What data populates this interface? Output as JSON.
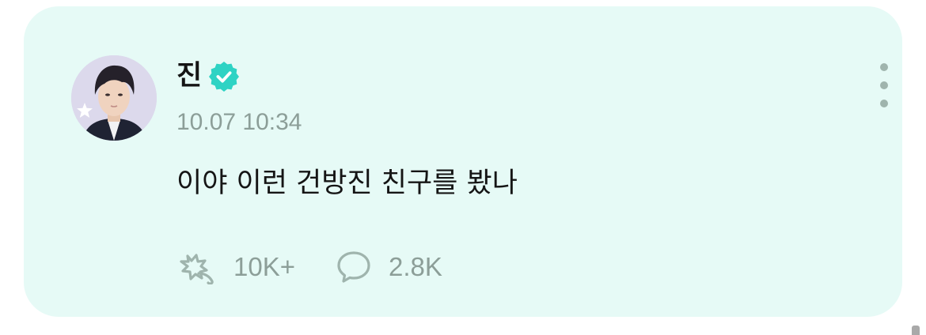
{
  "post": {
    "author": "진",
    "timestamp": "10.07 10:34",
    "text": "이야 이런 건방진 친구를 봤나",
    "likes": "10K+",
    "comments": "2.8K"
  },
  "icons": {
    "avatar": "profile-photo",
    "verified": "check-badge-icon",
    "more": "vertical-ellipsis-icon",
    "like": "applause-icon",
    "comment": "speech-bubble-icon"
  },
  "colors": {
    "card_background": "#e6faf6",
    "verified_badge": "#2ed3c4",
    "muted_text": "#8c9e98"
  }
}
